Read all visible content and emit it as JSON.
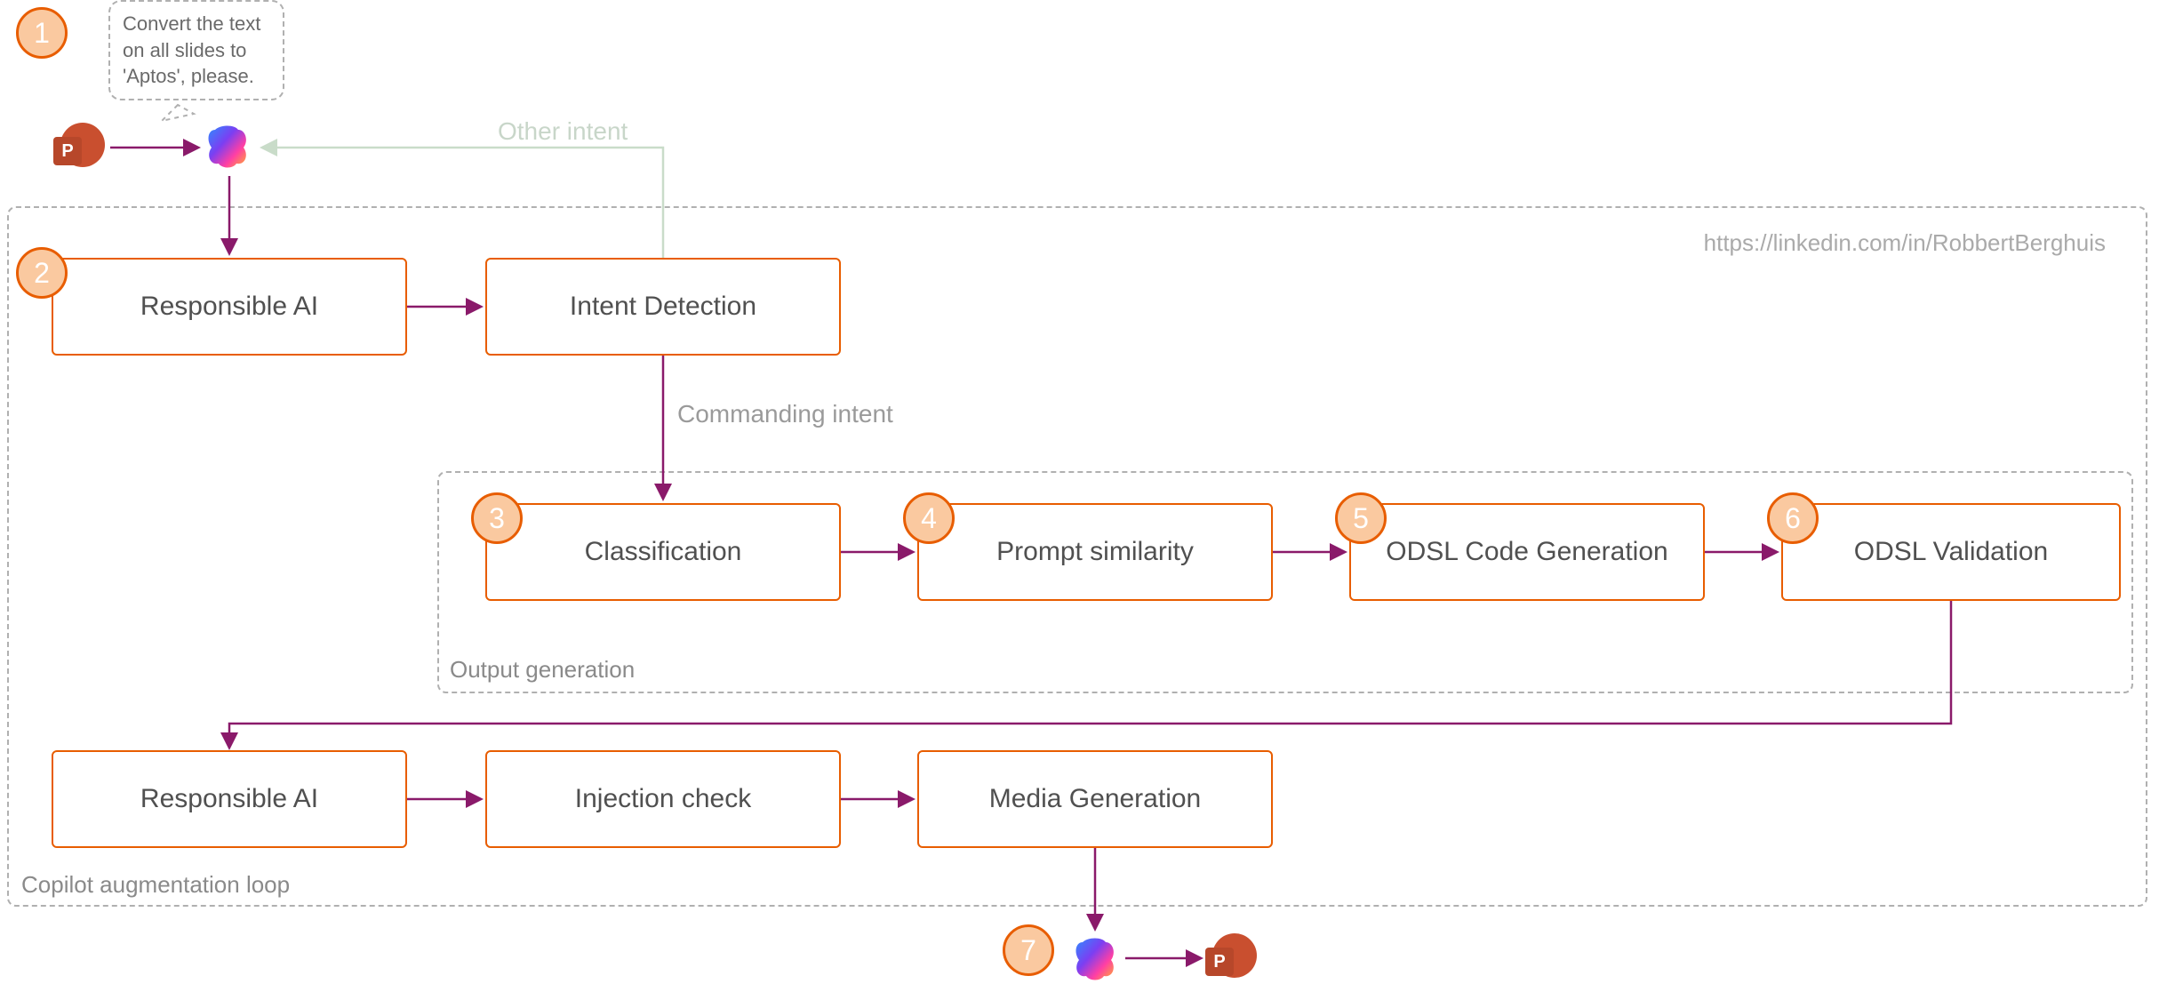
{
  "speech_bubble": "Convert the text on all slides to 'Aptos', please.",
  "url_text": "https://linkedin.com/in/RobbertBerghuis",
  "edge_labels": {
    "other_intent": "Other intent",
    "commanding_intent": "Commanding intent"
  },
  "groups": {
    "outer": {
      "label": "Copilot augmentation loop"
    },
    "inner": {
      "label": "Output generation"
    }
  },
  "nodes": {
    "responsible_ai_1": "Responsible AI",
    "intent_detection": "Intent Detection",
    "classification": "Classification",
    "prompt_similarity": "Prompt similarity",
    "odsl_code_generation": "ODSL Code Generation",
    "odsl_validation": "ODSL Validation",
    "responsible_ai_2": "Responsible AI",
    "injection_check": "Injection check",
    "media_generation": "Media Generation"
  },
  "badges": {
    "b1": "1",
    "b2": "2",
    "b3": "3",
    "b4": "4",
    "b5": "5",
    "b6": "6",
    "b7": "7"
  },
  "icons": {
    "powerpoint_letter": "P"
  }
}
